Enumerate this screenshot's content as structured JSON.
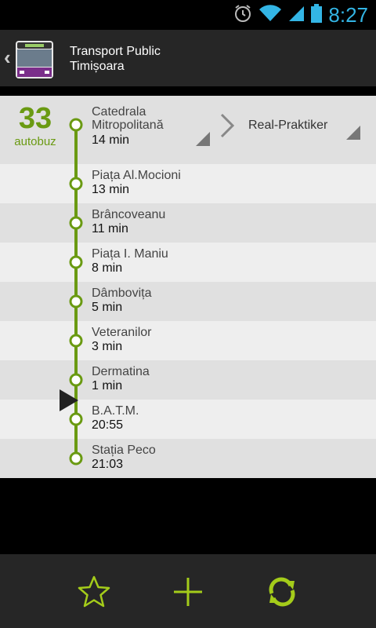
{
  "status_bar": {
    "time": "8:27",
    "icons": [
      "alarm-icon",
      "wifi-icon",
      "signal-icon",
      "battery-icon"
    ]
  },
  "action_bar": {
    "title_line1": "Transport Public",
    "title_line2": "Timișoara",
    "icon": "bus-icon"
  },
  "header": {
    "line_number": "33",
    "line_type": "autobuz",
    "current_stop_line1": "Catedrala",
    "current_stop_line2": "Mitropolitană",
    "current_time": "14 min",
    "destination": "Real-Praktiker"
  },
  "stops": [
    {
      "name": "Piața Al.Mocioni",
      "time": "13 min"
    },
    {
      "name": "Brâncoveanu",
      "time": "11 min"
    },
    {
      "name": "Piața I. Maniu",
      "time": "8 min"
    },
    {
      "name": "Dâmbovița",
      "time": "5 min"
    },
    {
      "name": "Veteranilor",
      "time": "3 min"
    },
    {
      "name": "Dermatina",
      "time": "1 min"
    },
    {
      "name": "B.A.T.M.",
      "time": "20:55"
    },
    {
      "name": "Stația Peco",
      "time": "21:03"
    }
  ],
  "bottom_bar": {
    "buttons": [
      "star-icon",
      "add-icon",
      "refresh-icon"
    ]
  },
  "colors": {
    "accent": "#6a9a12",
    "icon_green": "#a4cc1a",
    "status_blue": "#33b5e5"
  }
}
